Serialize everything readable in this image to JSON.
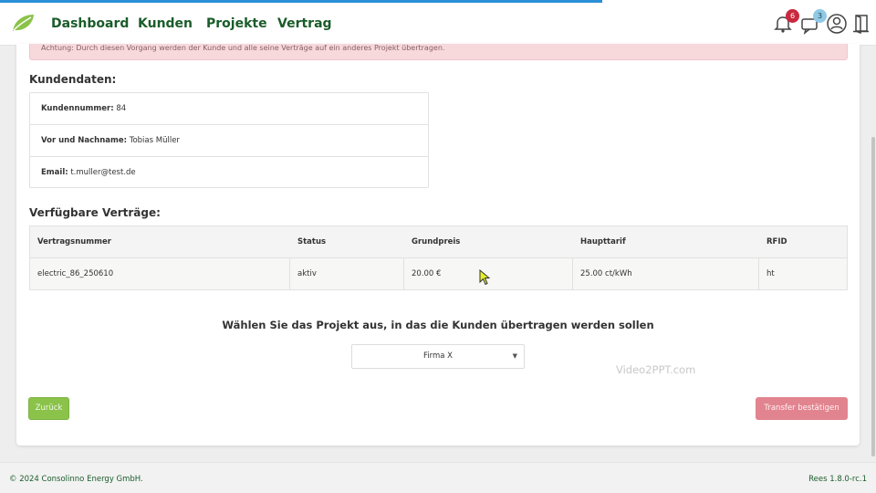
{
  "nav": {
    "items": [
      "Dashboard",
      "Kunden",
      "Projekte",
      "Vertrag"
    ],
    "notifications_badge": "6",
    "messages_badge": "3",
    "icons": [
      "logo-leaf-icon",
      "bell-icon",
      "chat-icon",
      "user-icon",
      "logout-icon"
    ],
    "accent_color": "#1a5c2a"
  },
  "alert": {
    "text": "Achtung: Durch diesen Vorgang werden der Kunde und alle seine Verträge auf ein anderes Projekt übertragen."
  },
  "customer": {
    "section_title": "Kundendaten:",
    "number_label": "Kundennummer:",
    "number_value": "84",
    "name_label": "Vor und Nachname:",
    "name_value": "Tobias Müller",
    "email_label": "Email:",
    "email_value": "t.muller@test.de"
  },
  "contracts": {
    "section_title": "Verfügbare Verträge:",
    "columns": [
      "Vertragsnummer",
      "Status",
      "Grundpreis",
      "Haupttarif",
      "RFID"
    ],
    "rows": [
      [
        "electric_86_250610",
        "aktiv",
        "20.00 €",
        "25.00 ct/kWh",
        "ht"
      ]
    ]
  },
  "project_select": {
    "label": "Wählen Sie das Projekt aus, in das die Kunden übertragen werden sollen",
    "selected": "Firma X"
  },
  "watermark": "Video2PPT.com",
  "buttons": {
    "back": "Zurück",
    "confirm": "Transfer bestätigen",
    "back_color": "#8bc34a",
    "confirm_color": "#e2848f"
  },
  "footer": {
    "copyright": "© 2024 Consolinno Energy GmbH.",
    "version": "Rees 1.8.0-rc.1"
  }
}
